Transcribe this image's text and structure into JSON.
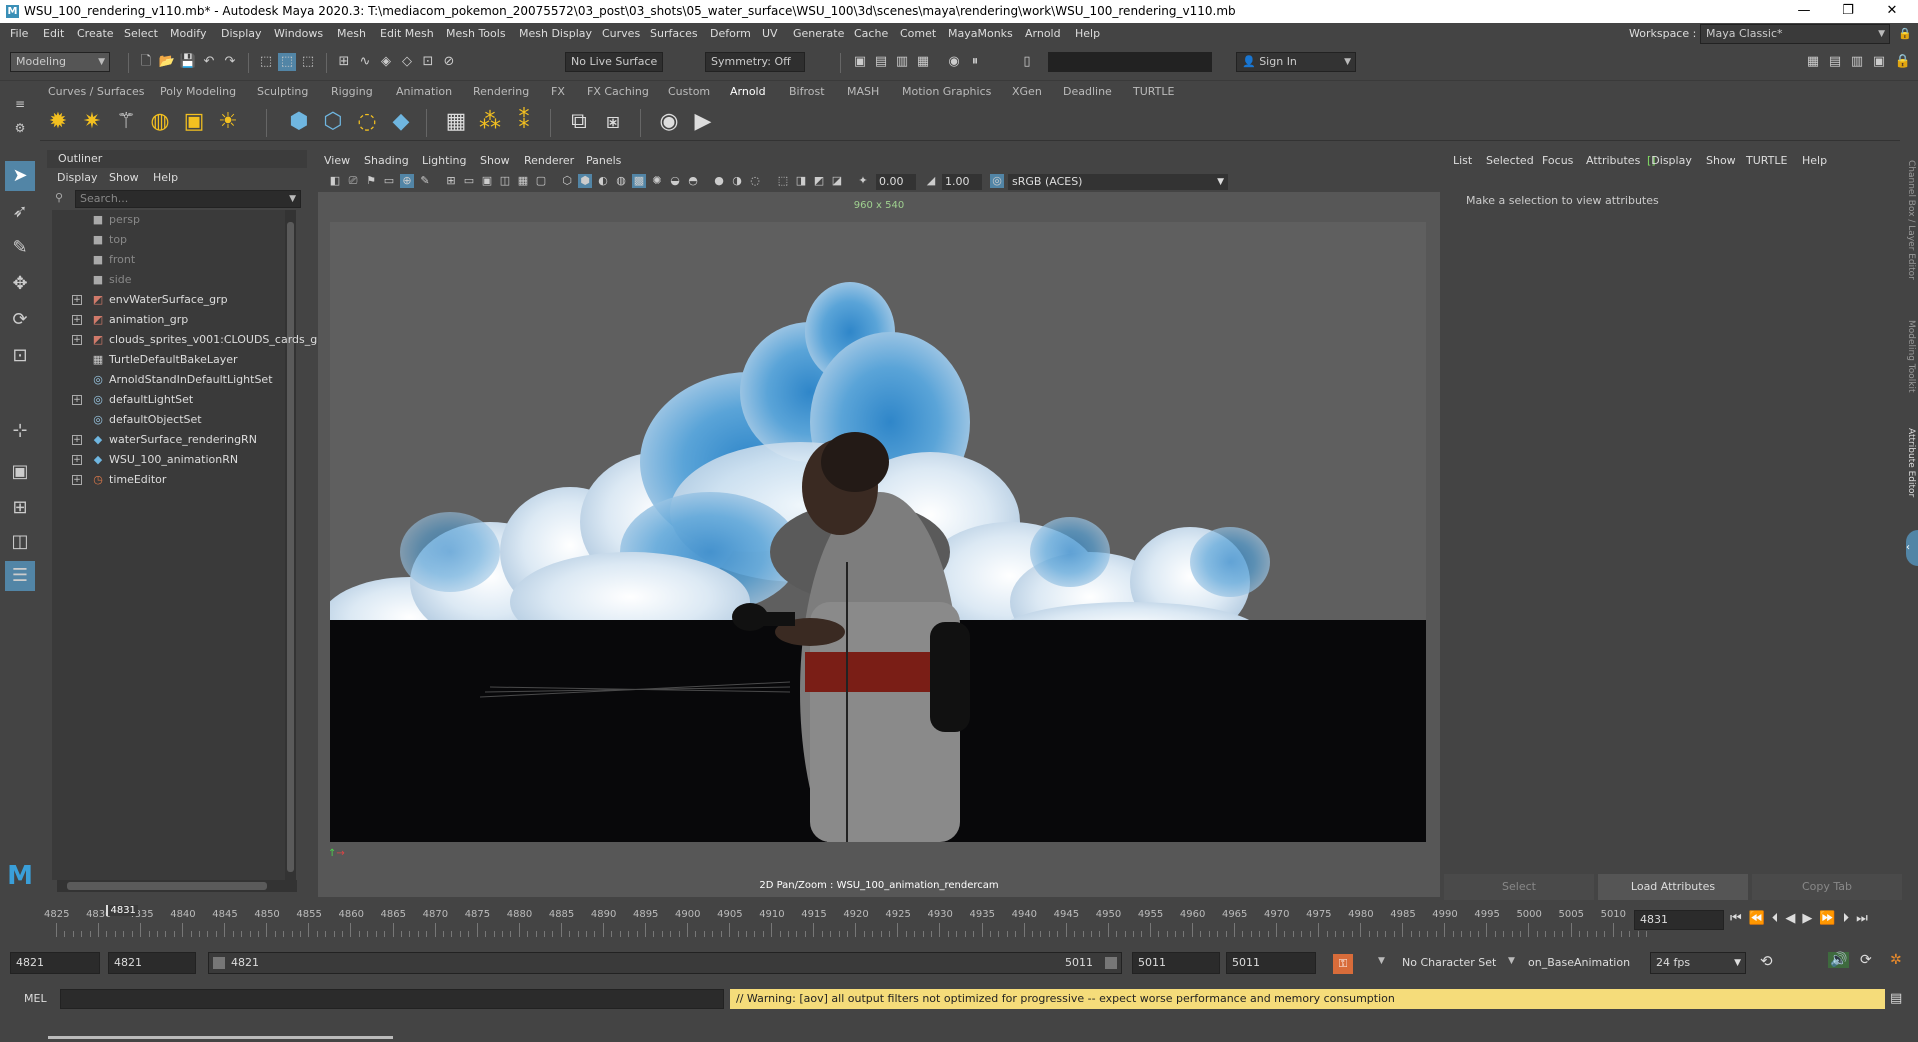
{
  "window": {
    "title": "WSU_100_rendering_v110.mb* - Autodesk Maya 2020.3: T:\\mediacom_pokemon_20075572\\03_post\\03_shots\\05_water_surface\\WSU_100\\3d\\scenes\\maya\\rendering\\work\\WSU_100_rendering_v110.mb",
    "minimize": "—",
    "restore": "❐",
    "close": "✕"
  },
  "menubar": {
    "items": [
      "File",
      "Edit",
      "Create",
      "Select",
      "Modify",
      "Display",
      "Windows",
      "Mesh",
      "Edit Mesh",
      "Mesh Tools",
      "Mesh Display",
      "Curves",
      "Surfaces",
      "Deform",
      "UV",
      "Generate",
      "Cache",
      "Comet",
      "MayaMonks",
      "Arnold",
      "Help"
    ],
    "workspace_label": "Workspace :",
    "workspace_value": "Maya Classic*"
  },
  "toolbar": {
    "mode": "Modeling",
    "live_surface": "No Live Surface",
    "symmetry": "Symmetry: Off",
    "sign_in": "Sign In"
  },
  "shelf": {
    "tabs": [
      "Curves / Surfaces",
      "Poly Modeling",
      "Sculpting",
      "Rigging",
      "Animation",
      "Rendering",
      "FX",
      "FX Caching",
      "Custom",
      "Arnold",
      "Bifrost",
      "MASH",
      "Motion Graphics",
      "XGen",
      "Deadline",
      "TURTLE"
    ],
    "active_tab": "Arnold"
  },
  "outliner": {
    "title": "Outliner",
    "menu": [
      "Display",
      "Show",
      "Help"
    ],
    "search_placeholder": "Search...",
    "items": [
      {
        "label": "persp",
        "icon": "camera-icon",
        "dim": true,
        "expand": false
      },
      {
        "label": "top",
        "icon": "camera-icon",
        "dim": true,
        "expand": false
      },
      {
        "label": "front",
        "icon": "camera-icon",
        "dim": true,
        "expand": false
      },
      {
        "label": "side",
        "icon": "camera-icon",
        "dim": true,
        "expand": false
      },
      {
        "label": "envWaterSurface_grp",
        "icon": "group-icon",
        "dim": false,
        "expand": true
      },
      {
        "label": "animation_grp",
        "icon": "group-icon",
        "dim": false,
        "expand": true
      },
      {
        "label": "clouds_sprites_v001:CLOUDS_cards_g",
        "icon": "group-icon",
        "dim": false,
        "expand": true
      },
      {
        "label": "TurtleDefaultBakeLayer",
        "icon": "bake-layer-icon",
        "dim": false,
        "expand": false
      },
      {
        "label": "ArnoldStandInDefaultLightSet",
        "icon": "set-icon",
        "dim": false,
        "expand": false
      },
      {
        "label": "defaultLightSet",
        "icon": "set-icon",
        "dim": false,
        "expand": true
      },
      {
        "label": "defaultObjectSet",
        "icon": "set-icon",
        "dim": false,
        "expand": false
      },
      {
        "label": "waterSurface_renderingRN",
        "icon": "reference-icon",
        "dim": false,
        "expand": true
      },
      {
        "label": "WSU_100_animationRN",
        "icon": "reference-icon",
        "dim": false,
        "expand": true
      },
      {
        "label": "timeEditor",
        "icon": "time-editor-icon",
        "dim": false,
        "expand": true
      }
    ]
  },
  "viewport": {
    "menu": [
      "View",
      "Shading",
      "Lighting",
      "Show",
      "Renderer",
      "Panels"
    ],
    "exposure": "0.00",
    "gamma": "1.00",
    "color_space": "sRGB (ACES)",
    "resolution": "960 x 540",
    "camera_label": "2D Pan/Zoom : WSU_100_animation_rendercam"
  },
  "attribute_editor": {
    "menu": [
      "List",
      "Selected",
      "Focus",
      "Attributes",
      "Display",
      "Show",
      "TURTLE",
      "Help"
    ],
    "active_menu": "Display",
    "message": "Make a selection to view attributes",
    "buttons": {
      "select": "Select",
      "load": "Load Attributes",
      "copy": "Copy Tab"
    },
    "side_tabs": [
      "Channel Box / Layer Editor",
      "Modeling Toolkit",
      "Attribute Editor"
    ]
  },
  "timeline": {
    "ticks": [
      "4825",
      "4830",
      "4835",
      "4840",
      "4845",
      "4850",
      "4855",
      "4860",
      "4865",
      "4870",
      "4875",
      "4880",
      "4885",
      "4890",
      "4895",
      "4900",
      "4905",
      "4910",
      "4915",
      "4920",
      "4925",
      "4930",
      "4935",
      "4940",
      "4945",
      "4950",
      "4955",
      "4960",
      "4965",
      "4970",
      "4975",
      "4980",
      "4985",
      "4990",
      "4995",
      "5000",
      "5005",
      "5010"
    ],
    "current_marker": "4831",
    "current_frame": "4831"
  },
  "range": {
    "start": "4821",
    "playback_start": "4821",
    "slider_start": "4821",
    "slider_end": "5011",
    "playback_end": "5011",
    "end": "5011",
    "character_set": "No Character Set",
    "anim_layer": "on_BaseAnimation",
    "fps": "24 fps"
  },
  "command": {
    "label": "MEL",
    "warning": "// Warning: [aov] all output filters not optimized for progressive -- expect worse performance and memory consumption"
  },
  "colors": {
    "accent": "#5285a6",
    "warning_bg": "#f5dc7a",
    "display_active": "#7fdc62"
  }
}
